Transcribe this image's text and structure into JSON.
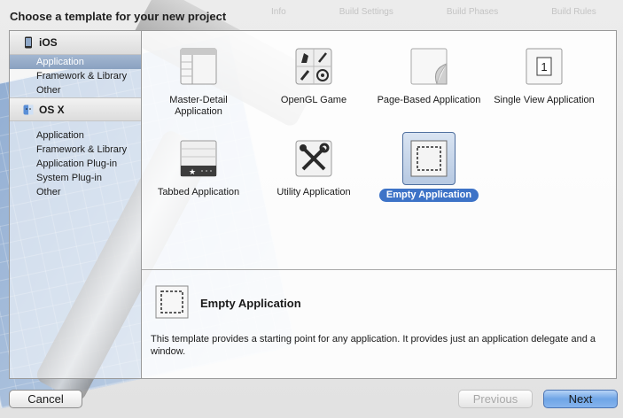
{
  "title": "Choose a template for your new project",
  "background_toolbar": [
    "Info",
    "Build Settings",
    "Build Phases",
    "Build Rules"
  ],
  "sidebar": {
    "sections": [
      {
        "header": "iOS",
        "icon": "iphone-icon",
        "items": [
          "Application",
          "Framework & Library",
          "Other"
        ],
        "selected_index": 0
      },
      {
        "header": "OS X",
        "icon": "finder-icon",
        "items": [
          "Application",
          "Framework & Library",
          "Application Plug-in",
          "System Plug-in",
          "Other"
        ],
        "selected_index": -1
      }
    ]
  },
  "templates": [
    {
      "label": "Master-Detail Application",
      "icon": "master-detail-icon"
    },
    {
      "label": "OpenGL Game",
      "icon": "opengl-game-icon"
    },
    {
      "label": "Page-Based Application",
      "icon": "page-curl-icon"
    },
    {
      "label": "Single View Application",
      "icon": "single-view-icon"
    },
    {
      "label": "Tabbed Application",
      "icon": "tab-bar-icon"
    },
    {
      "label": "Utility Application",
      "icon": "utility-tools-icon"
    },
    {
      "label": "Empty Application",
      "icon": "empty-app-icon",
      "selected": true
    }
  ],
  "description": {
    "title": "Empty Application",
    "text": "This template provides a starting point for any application. It provides just an application delegate and a window."
  },
  "buttons": {
    "cancel": "Cancel",
    "previous": "Previous",
    "next": "Next"
  },
  "colors": {
    "selection_blue": "#3d73c7",
    "sidebar_selection": "#8aa1c0",
    "next_button": "#6fa5e6"
  }
}
